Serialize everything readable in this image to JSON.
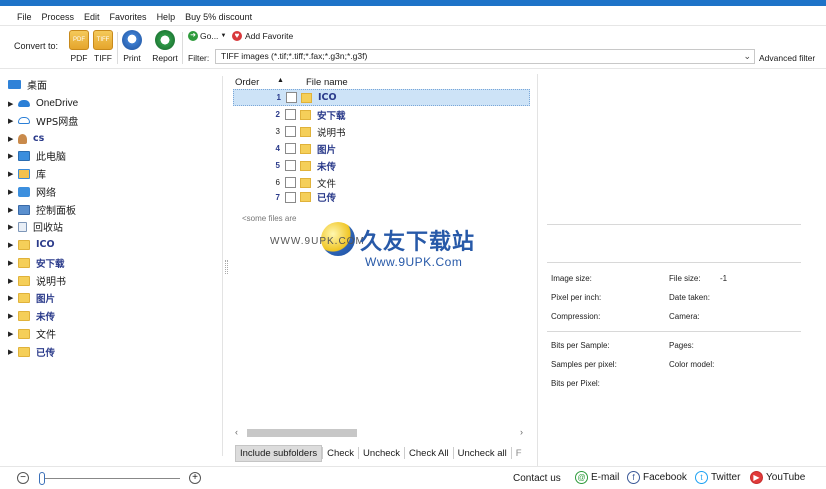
{
  "menu": [
    "File",
    "Process",
    "Edit",
    "Favorites",
    "Help",
    "Buy 5% discount"
  ],
  "toolbar": {
    "convert_to": "Convert to:",
    "pdf_label": "PDF",
    "tiff_label": "TIFF",
    "print_label": "Print",
    "report_label": "Report",
    "pdf_icon_text": "PDF",
    "tiff_icon_text": "TIFF",
    "go_label": "Go...",
    "add_favorite": "Add Favorite",
    "filter_label": "Filter:",
    "filter_value": "TIFF images (*.tif;*.tiff;*.fax;*.g3n;*.g3f)",
    "advanced_filter": "Advanced filter"
  },
  "tree": [
    {
      "label": "桌面",
      "icon": "desktop-icon"
    },
    {
      "label": "OneDrive",
      "icon": "onedrive-icon"
    },
    {
      "label": "WPS网盘",
      "icon": "cloud-icon"
    },
    {
      "label": "cs",
      "icon": "user-icon"
    },
    {
      "label": "此电脑",
      "icon": "computer-icon"
    },
    {
      "label": "库",
      "icon": "library-icon"
    },
    {
      "label": "网络",
      "icon": "network-icon"
    },
    {
      "label": "控制面板",
      "icon": "control-panel-icon"
    },
    {
      "label": "回收站",
      "icon": "recycle-bin-icon"
    },
    {
      "label": "ICO",
      "icon": "folder-icon"
    },
    {
      "label": "安下载",
      "icon": "folder-icon"
    },
    {
      "label": "说明书",
      "icon": "folder-icon"
    },
    {
      "label": "图片",
      "icon": "folder-icon"
    },
    {
      "label": "未传",
      "icon": "folder-icon"
    },
    {
      "label": "文件",
      "icon": "folder-icon"
    },
    {
      "label": "已传",
      "icon": "folder-icon"
    }
  ],
  "list": {
    "col_order": "Order",
    "col_name": "File name",
    "rows": [
      {
        "num": "1",
        "name": "ICO"
      },
      {
        "num": "2",
        "name": "安下载"
      },
      {
        "num": "3",
        "name": "说明书"
      },
      {
        "num": "4",
        "name": "图片"
      },
      {
        "num": "5",
        "name": "未传"
      },
      {
        "num": "6",
        "name": "文件"
      },
      {
        "num": "7",
        "name": "已传"
      }
    ],
    "some_files": "<some files are",
    "actions": [
      "Include subfolders",
      "Check",
      "Uncheck",
      "Check All",
      "Uncheck all",
      "F"
    ]
  },
  "watermark": {
    "cn": "久友下载站",
    "url1": "WWW.9UPK.COM",
    "url2": "Www.9UPK.Com"
  },
  "info": {
    "image_size": "Image size:",
    "file_size": "File size:",
    "file_size_val": "-1",
    "ppi": "Pixel per inch:",
    "date_taken": "Date taken:",
    "compression": "Compression:",
    "camera": "Camera:",
    "bps": "Bits per Sample:",
    "pages": "Pages:",
    "spp": "Samples per pixel:",
    "color_model": "Color model:",
    "bpp": "Bits per Pixel:"
  },
  "footer": {
    "contact": "Contact us",
    "email": "E-mail",
    "facebook": "Facebook",
    "twitter": "Twitter",
    "youtube": "YouTube"
  }
}
